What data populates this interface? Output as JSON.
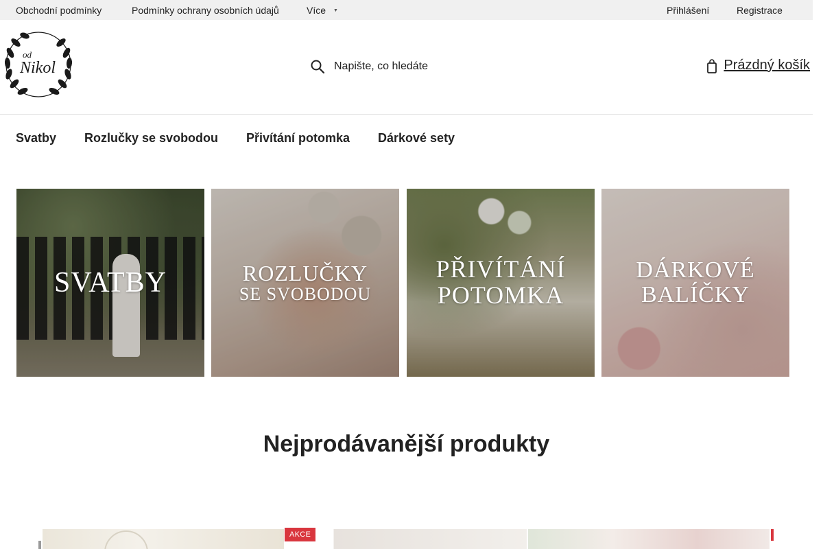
{
  "topbar": {
    "links": [
      "Obchodní podmínky",
      "Podmínky ochrany osobních údajů",
      "Více"
    ],
    "account": [
      "Přihlášení",
      "Registrace"
    ]
  },
  "header": {
    "logo": {
      "line1": "od",
      "line2": "Nikol"
    },
    "search_placeholder": "Napište, co hledáte",
    "cart_label": "Prázdný košík"
  },
  "nav": {
    "items": [
      "Svatby",
      "Rozlučky se svobodou",
      "Přivítání potomka",
      "Dárkové sety"
    ]
  },
  "banners": [
    {
      "line1": "Svatby",
      "line2": ""
    },
    {
      "line1": "Rozlučky",
      "line2": "se svobodou"
    },
    {
      "line1": "Přivítání",
      "line2": "potomka"
    },
    {
      "line1": "Dárkové",
      "line2": "balíčky"
    }
  ],
  "bestsellers": {
    "title": "Nejprodávanější produkty",
    "badge": "AKCE"
  },
  "colors": {
    "topbar_bg": "#f0f0f0",
    "sale_badge": "#d9363e",
    "text": "#222222"
  }
}
